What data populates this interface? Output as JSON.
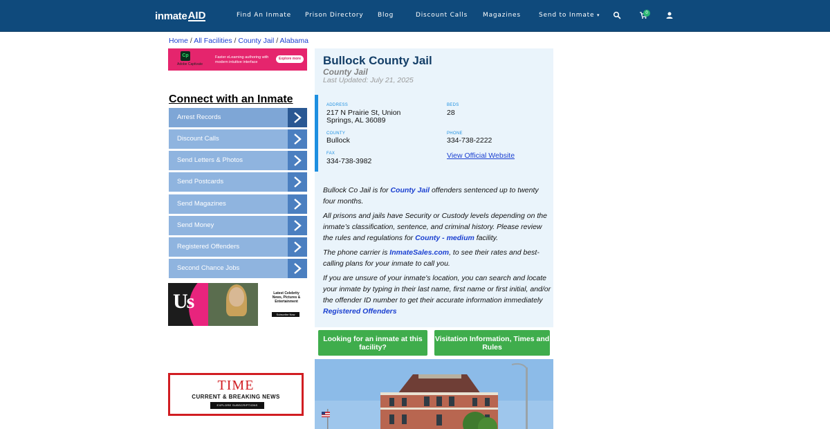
{
  "nav": {
    "logo_part1": "inmate",
    "logo_part2": "AID",
    "links": [
      "Find An Inmate",
      "Prison Directory",
      "Blog",
      "Discount Calls",
      "Magazines",
      "Send to Inmate"
    ],
    "cart_count": "0",
    "icons": [
      "search-icon",
      "cart-icon",
      "user-icon",
      "caret-down-icon"
    ]
  },
  "breadcrumb": [
    "Home",
    "All Facilities",
    "County Jail",
    "Alabama"
  ],
  "ad_captivate": {
    "badge": "Cp",
    "brand": "Adobe Captivate",
    "copy": "Faster eLearning authoring with modern intuitive interface",
    "button": "Explore more"
  },
  "connect": {
    "title": "Connect with an Inmate",
    "items": [
      "Arrest Records",
      "Discount Calls",
      "Send Letters & Photos",
      "Send Postcards",
      "Send Magazines",
      "Send Money",
      "Registered Offenders",
      "Second Chance Jobs"
    ]
  },
  "ad_us": {
    "logo": "Us",
    "tagline": "Latest Celebrity News, Pictures & Entertainment",
    "button": "Subscribe Now"
  },
  "ad_time": {
    "logo": "TIME",
    "headline": "CURRENT & BREAKING NEWS",
    "button": "EXPLORE SUBSCRIPTIONS"
  },
  "facility": {
    "name": "Bullock County Jail",
    "type": "County Jail",
    "updated": "Last Updated: July 21, 2025",
    "address_label": "ADDRESS",
    "address_line1": "217 N Prairie St, Union",
    "address_line2": "Springs, AL 36089",
    "beds_label": "BEDS",
    "beds": "28",
    "county_label": "COUNTY",
    "county": "Bullock",
    "phone_label": "PHONE",
    "phone": "334-738-2222",
    "fax_label": "FAX",
    "fax": "334-738-3982",
    "website_link": "View Official Website"
  },
  "description": {
    "p1_a": "Bullock Co Jail is for ",
    "p1_link": "County Jail",
    "p1_b": " offenders sentenced up to twenty four months.",
    "p2_a": "All prisons and jails have Security or Custody levels depending on the inmate’s classification, sentence, and criminal history. Please review the rules and regulations for ",
    "p2_link": "County - medium",
    "p2_b": " facility.",
    "p3_a": "The phone carrier is ",
    "p3_link": "InmateSales.com",
    "p3_b": ", to see their rates and best-calling plans for your inmate to call you.",
    "p4_a": "If you are unsure of your inmate's location, you can search and locate your inmate by typing in their last name, first name or first initial, and/or the offender ID number to get their accurate information immediately ",
    "p4_link": "Registered Offenders"
  },
  "buttons": {
    "find_inmate": "Looking for an inmate at this facility?",
    "visitation": "Visitation Information, Times and Rules"
  }
}
